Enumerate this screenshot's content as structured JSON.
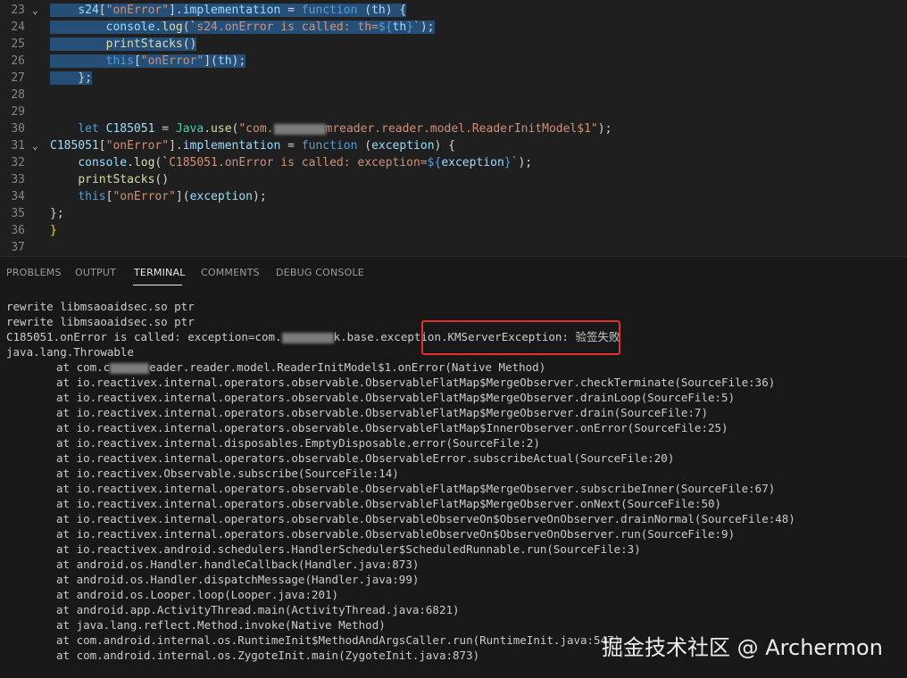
{
  "editor": {
    "lines": [
      {
        "n": "23",
        "fold": "⌄",
        "ind": "    ",
        "sel": true,
        "t": [
          [
            "pr",
            "s24"
          ],
          [
            "tx",
            "["
          ],
          [
            "st",
            "\"onError\""
          ],
          [
            "tx",
            "]."
          ],
          [
            "pr",
            "implementation"
          ],
          [
            "tx",
            " = "
          ],
          [
            "kw",
            "function"
          ],
          [
            "tx",
            " ("
          ],
          [
            "pr",
            "th"
          ],
          [
            "tx",
            ") {"
          ]
        ]
      },
      {
        "n": "24",
        "fold": "",
        "ind": "        ",
        "sel": true,
        "t": [
          [
            "pr",
            "console"
          ],
          [
            "tx",
            "."
          ],
          [
            "fn",
            "log"
          ],
          [
            "tx",
            "(`"
          ],
          [
            "st",
            "s24.onError is called: th="
          ],
          [
            "kw",
            "${"
          ],
          [
            "pr",
            "th"
          ],
          [
            "kw",
            "}"
          ],
          [
            "st",
            "`"
          ],
          [
            "tx",
            ");"
          ]
        ]
      },
      {
        "n": "25",
        "fold": "",
        "ind": "        ",
        "sel": true,
        "t": [
          [
            "fn",
            "printStacks"
          ],
          [
            "tx",
            "()"
          ]
        ]
      },
      {
        "n": "26",
        "fold": "",
        "ind": "        ",
        "sel": true,
        "t": [
          [
            "kw",
            "this"
          ],
          [
            "tx",
            "["
          ],
          [
            "st",
            "\"onError\""
          ],
          [
            "tx",
            "]("
          ],
          [
            "pr",
            "th"
          ],
          [
            "tx",
            ");"
          ]
        ]
      },
      {
        "n": "27",
        "fold": "",
        "ind": "    ",
        "sel": true,
        "t": [
          [
            "tx",
            "};"
          ]
        ]
      },
      {
        "n": "28",
        "fold": "",
        "ind": "",
        "sel": false,
        "t": []
      },
      {
        "n": "29",
        "fold": "",
        "ind": "",
        "sel": false,
        "t": []
      },
      {
        "n": "30",
        "fold": "",
        "ind": "    ",
        "sel": false,
        "t": [
          [
            "kw",
            "let "
          ],
          [
            "pr",
            "C185051"
          ],
          [
            "tx",
            " = "
          ],
          [
            "ty",
            "Java"
          ],
          [
            "tx",
            "."
          ],
          [
            "fn",
            "use"
          ],
          [
            "tx",
            "("
          ],
          [
            "st",
            "\"com."
          ],
          [
            "blur",
            "58"
          ],
          [
            "st",
            "mreader.reader.model.ReaderInitModel$1\""
          ],
          [
            "tx",
            ");"
          ]
        ]
      },
      {
        "n": "31",
        "fold": "⌄",
        "ind": "",
        "sel": false,
        "t": [
          [
            "pr",
            "C185051"
          ],
          [
            "tx",
            "["
          ],
          [
            "st",
            "\"onError\""
          ],
          [
            "tx",
            "]."
          ],
          [
            "pr",
            "implementation"
          ],
          [
            "tx",
            " = "
          ],
          [
            "kw",
            "function"
          ],
          [
            "tx",
            " ("
          ],
          [
            "pr",
            "exception"
          ],
          [
            "tx",
            ") {"
          ]
        ]
      },
      {
        "n": "32",
        "fold": "",
        "ind": "    ",
        "sel": false,
        "t": [
          [
            "pr",
            "console"
          ],
          [
            "tx",
            "."
          ],
          [
            "fn",
            "log"
          ],
          [
            "tx",
            "(`"
          ],
          [
            "st",
            "C185051.onError is called: exception="
          ],
          [
            "kw",
            "${"
          ],
          [
            "pr",
            "exception"
          ],
          [
            "kw",
            "}"
          ],
          [
            "st",
            "`"
          ],
          [
            "tx",
            ");"
          ]
        ]
      },
      {
        "n": "33",
        "fold": "",
        "ind": "    ",
        "sel": false,
        "t": [
          [
            "fn",
            "printStacks"
          ],
          [
            "tx",
            "()"
          ]
        ]
      },
      {
        "n": "34",
        "fold": "",
        "ind": "    ",
        "sel": false,
        "t": [
          [
            "kw",
            "this"
          ],
          [
            "tx",
            "["
          ],
          [
            "st",
            "\"onError\""
          ],
          [
            "tx",
            "]("
          ],
          [
            "pr",
            "exception"
          ],
          [
            "tx",
            ");"
          ]
        ]
      },
      {
        "n": "35",
        "fold": "",
        "ind": "",
        "sel": false,
        "t": [
          [
            "tx",
            "};"
          ]
        ]
      },
      {
        "n": "36",
        "fold": "",
        "ind": "",
        "sel": false,
        "t": [
          [
            "bk",
            "}"
          ]
        ]
      },
      {
        "n": "37",
        "fold": "",
        "ind": "",
        "sel": false,
        "t": []
      }
    ]
  },
  "panel": {
    "tabs": [
      {
        "id": "problems",
        "label": "PROBLEMS",
        "active": false
      },
      {
        "id": "output",
        "label": "OUTPUT",
        "active": false
      },
      {
        "id": "terminal",
        "label": "TERMINAL",
        "active": true
      },
      {
        "id": "comments",
        "label": "COMMENTS",
        "active": false
      },
      {
        "id": "debug-console",
        "label": "DEBUG CONSOLE",
        "active": false
      }
    ]
  },
  "terminal": {
    "lines": [
      {
        "indent": false,
        "t": [
          [
            "",
            "rewrite libmsaoaidsec.so ptr"
          ]
        ]
      },
      {
        "indent": false,
        "t": [
          [
            "",
            "rewrite libmsaoaidsec.so ptr"
          ]
        ]
      },
      {
        "indent": false,
        "t": [
          [
            "",
            "C185051.onError is called: exception=com."
          ],
          [
            "blur",
            "58"
          ],
          [
            "",
            "k.base.exception.KMServerException: 验签失败"
          ]
        ]
      },
      {
        "indent": false,
        "t": [
          [
            "",
            "java.lang.Throwable"
          ]
        ]
      },
      {
        "indent": true,
        "t": [
          [
            "",
            "at com.c"
          ],
          [
            "blur",
            "44"
          ],
          [
            "",
            "eader.reader.model.ReaderInitModel$1.onError(Native Method)"
          ]
        ]
      },
      {
        "indent": true,
        "t": [
          [
            "",
            "at io.reactivex.internal.operators.observable.ObservableFlatMap$MergeObserver.checkTerminate(SourceFile:36)"
          ]
        ]
      },
      {
        "indent": true,
        "t": [
          [
            "",
            "at io.reactivex.internal.operators.observable.ObservableFlatMap$MergeObserver.drainLoop(SourceFile:5)"
          ]
        ]
      },
      {
        "indent": true,
        "t": [
          [
            "",
            "at io.reactivex.internal.operators.observable.ObservableFlatMap$MergeObserver.drain(SourceFile:7)"
          ]
        ]
      },
      {
        "indent": true,
        "t": [
          [
            "",
            "at io.reactivex.internal.operators.observable.ObservableFlatMap$InnerObserver.onError(SourceFile:25)"
          ]
        ]
      },
      {
        "indent": true,
        "t": [
          [
            "",
            "at io.reactivex.internal.disposables.EmptyDisposable.error(SourceFile:2)"
          ]
        ]
      },
      {
        "indent": true,
        "t": [
          [
            "",
            "at io.reactivex.internal.operators.observable.ObservableError.subscribeActual(SourceFile:20)"
          ]
        ]
      },
      {
        "indent": true,
        "t": [
          [
            "",
            "at io.reactivex.Observable.subscribe(SourceFile:14)"
          ]
        ]
      },
      {
        "indent": true,
        "t": [
          [
            "",
            "at io.reactivex.internal.operators.observable.ObservableFlatMap$MergeObserver.subscribeInner(SourceFile:67)"
          ]
        ]
      },
      {
        "indent": true,
        "t": [
          [
            "",
            "at io.reactivex.internal.operators.observable.ObservableFlatMap$MergeObserver.onNext(SourceFile:50)"
          ]
        ]
      },
      {
        "indent": true,
        "t": [
          [
            "",
            "at io.reactivex.internal.operators.observable.ObservableObserveOn$ObserveOnObserver.drainNormal(SourceFile:48)"
          ]
        ]
      },
      {
        "indent": true,
        "t": [
          [
            "",
            "at io.reactivex.internal.operators.observable.ObservableObserveOn$ObserveOnObserver.run(SourceFile:9)"
          ]
        ]
      },
      {
        "indent": true,
        "t": [
          [
            "",
            "at io.reactivex.android.schedulers.HandlerScheduler$ScheduledRunnable.run(SourceFile:3)"
          ]
        ]
      },
      {
        "indent": true,
        "t": [
          [
            "",
            "at android.os.Handler.handleCallback(Handler.java:873)"
          ]
        ]
      },
      {
        "indent": true,
        "t": [
          [
            "",
            "at android.os.Handler.dispatchMessage(Handler.java:99)"
          ]
        ]
      },
      {
        "indent": true,
        "t": [
          [
            "",
            "at android.os.Looper.loop(Looper.java:201)"
          ]
        ]
      },
      {
        "indent": true,
        "t": [
          [
            "",
            "at android.app.ActivityThread.main(ActivityThread.java:6821)"
          ]
        ]
      },
      {
        "indent": true,
        "t": [
          [
            "",
            "at java.lang.reflect.Method.invoke(Native Method)"
          ]
        ]
      },
      {
        "indent": true,
        "t": [
          [
            "",
            "at com.android.internal.os.RuntimeInit$MethodAndArgsCaller.run(RuntimeInit.java:547)"
          ]
        ]
      },
      {
        "indent": true,
        "t": [
          [
            "",
            "at com.android.internal.os.ZygoteInit.main(ZygoteInit.java:873)"
          ]
        ]
      }
    ]
  },
  "watermark": {
    "text": "掘金技术社区 @ Archermon"
  }
}
